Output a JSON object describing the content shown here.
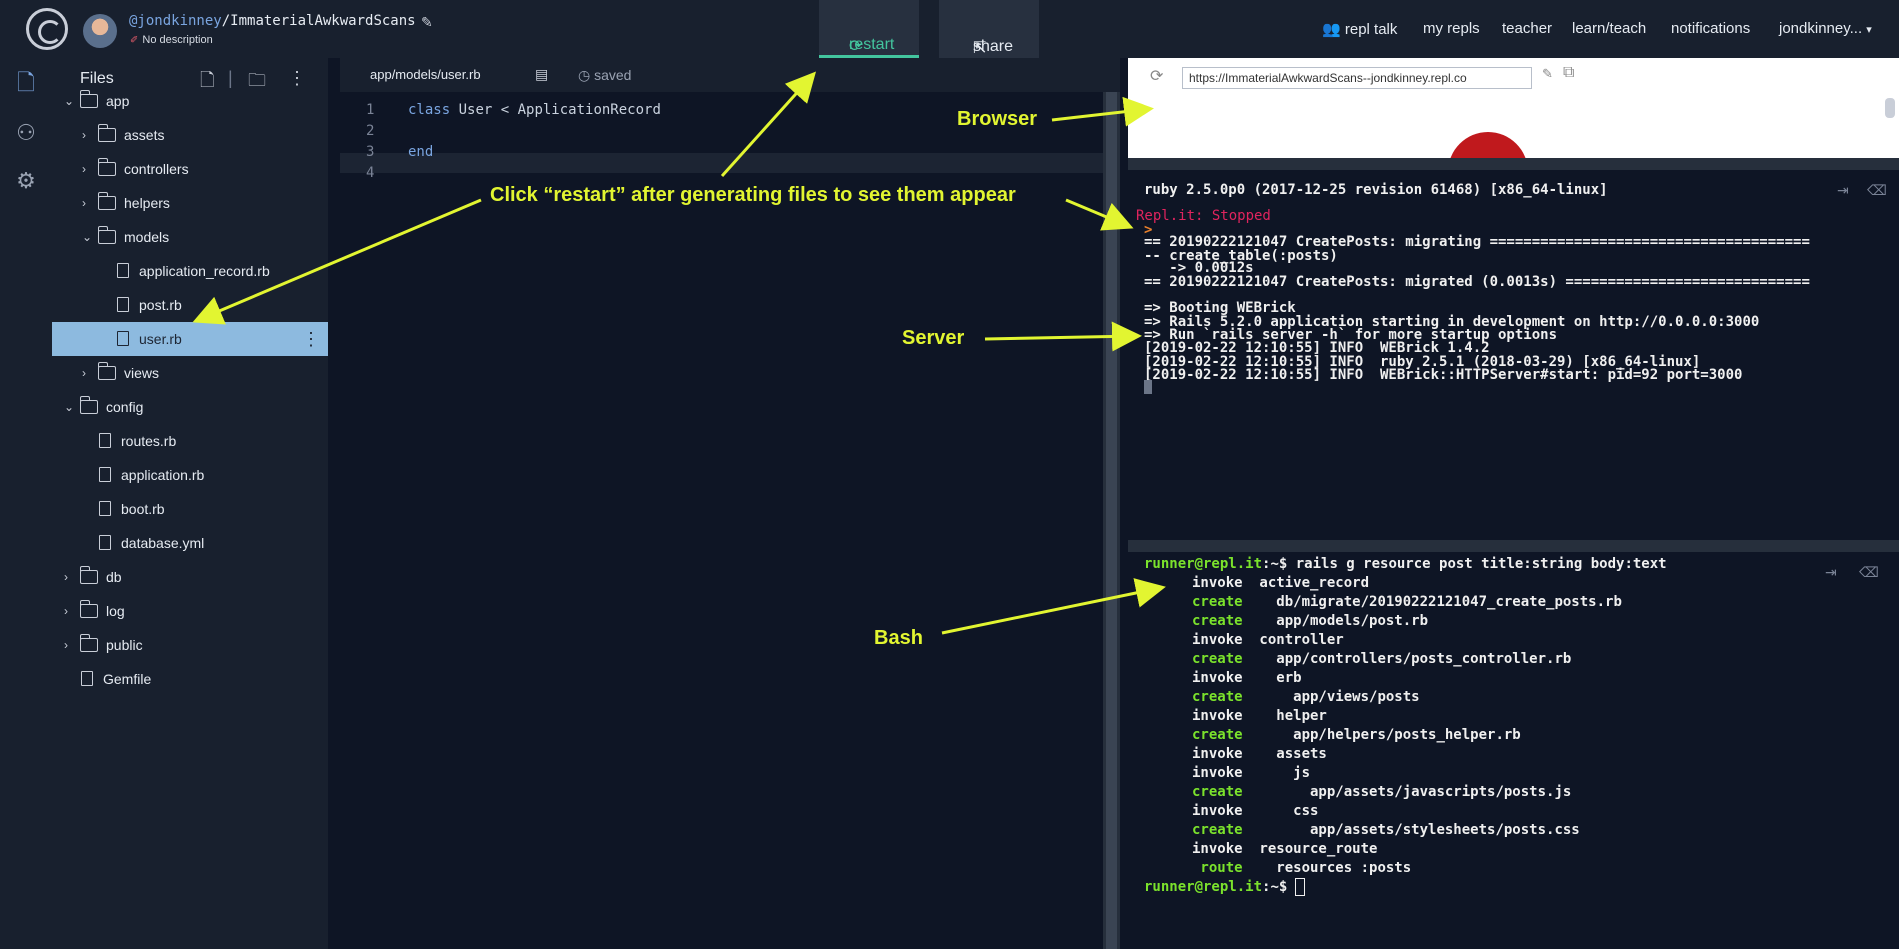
{
  "header": {
    "owner": "@jondkinney",
    "separator": "/",
    "repl_name": "ImmaterialAwkwardScans",
    "description": "No description",
    "restart_label": "restart",
    "share_label": "share",
    "nav": [
      "repl talk",
      "my repls",
      "teacher",
      "learn/teach",
      "notifications",
      "jondkinney..."
    ]
  },
  "files_panel": {
    "title": "Files",
    "tree": [
      {
        "name": "app",
        "type": "folder",
        "depth": 0,
        "open": true
      },
      {
        "name": "assets",
        "type": "folder",
        "depth": 1,
        "open": false
      },
      {
        "name": "controllers",
        "type": "folder",
        "depth": 1,
        "open": false
      },
      {
        "name": "helpers",
        "type": "folder",
        "depth": 1,
        "open": false
      },
      {
        "name": "models",
        "type": "folder",
        "depth": 1,
        "open": true
      },
      {
        "name": "application_record.rb",
        "type": "file",
        "depth": 2
      },
      {
        "name": "post.rb",
        "type": "file",
        "depth": 2
      },
      {
        "name": "user.rb",
        "type": "file",
        "depth": 2,
        "selected": true
      },
      {
        "name": "views",
        "type": "folder",
        "depth": 1,
        "open": false
      },
      {
        "name": "config",
        "type": "folder",
        "depth": 0,
        "open": true
      },
      {
        "name": "routes.rb",
        "type": "file",
        "depth": 1
      },
      {
        "name": "application.rb",
        "type": "file",
        "depth": 1
      },
      {
        "name": "boot.rb",
        "type": "file",
        "depth": 1
      },
      {
        "name": "database.yml",
        "type": "file",
        "depth": 1
      },
      {
        "name": "db",
        "type": "folder",
        "depth": 0,
        "open": false
      },
      {
        "name": "log",
        "type": "folder",
        "depth": 0,
        "open": false
      },
      {
        "name": "public",
        "type": "folder",
        "depth": 0,
        "open": false
      },
      {
        "name": "Gemfile",
        "type": "file",
        "depth": 0
      }
    ]
  },
  "editor": {
    "tab_path": "app/models/user.rb",
    "saved_label": "saved",
    "lines": [
      "1",
      "2",
      "3",
      "4"
    ],
    "code_line1_kw": "class",
    "code_line1_rest": " User < ApplicationRecord",
    "code_line3": "end"
  },
  "browser": {
    "url": "https://ImmaterialAwkwardScans--jondkinney.repl.co"
  },
  "console": {
    "lines": [
      "ruby 2.5.0p0 (2017-12-25 revision 61468) [x86_64-linux]",
      "Repl.it: Stopped",
      "> ",
      "== 20190222121047 CreatePosts: migrating ======================================",
      "-- create_table(:posts)",
      "   -> 0.0012s",
      "== 20190222121047 CreatePosts: migrated (0.0013s) =============================",
      "",
      "=> Booting WEBrick",
      "=> Rails 5.2.0 application starting in development on http://0.0.0.0:3000",
      "=> Run `rails server -h` for more startup options",
      "[2019-02-22 12:10:55] INFO  WEBrick 1.4.2",
      "[2019-02-22 12:10:55] INFO  ruby 2.5.1 (2018-03-29) [x86_64-linux]",
      "[2019-02-22 12:10:55] INFO  WEBrick::HTTPServer#start: pid=92 port=3000"
    ]
  },
  "bash": {
    "prompt": "runner@repl.it",
    "prompt_suffix": ":~$ ",
    "command": "rails g resource post title:string body:text",
    "lines": [
      [
        "invoke",
        "active_record"
      ],
      [
        "create",
        "  db/migrate/20190222121047_create_posts.rb"
      ],
      [
        "create",
        "  app/models/post.rb"
      ],
      [
        "invoke",
        "controller"
      ],
      [
        "create",
        "  app/controllers/posts_controller.rb"
      ],
      [
        "invoke",
        "  erb"
      ],
      [
        "create",
        "    app/views/posts"
      ],
      [
        "invoke",
        "  helper"
      ],
      [
        "create",
        "    app/helpers/posts_helper.rb"
      ],
      [
        "invoke",
        "  assets"
      ],
      [
        "invoke",
        "    js"
      ],
      [
        "create",
        "      app/assets/javascripts/posts.js"
      ],
      [
        "invoke",
        "    css"
      ],
      [
        "create",
        "      app/assets/stylesheets/posts.css"
      ],
      [
        "invoke",
        "resource_route"
      ],
      [
        " route",
        "  resources :posts"
      ]
    ]
  },
  "annotations": {
    "browser": "Browser",
    "restart_hint": "Click “restart” after generating files to see them appear",
    "server": "Server",
    "bash": "Bash"
  },
  "colors": {
    "accent": "#43c59e",
    "annotation": "#e2f531",
    "terminal_green": "#7be22c",
    "terminal_red": "#e0245e"
  }
}
